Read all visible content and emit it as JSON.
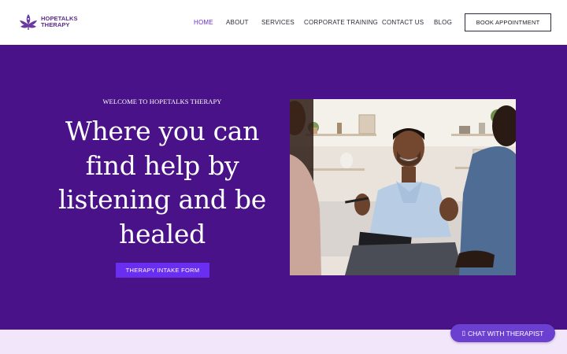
{
  "brand": {
    "name_line1": "HOPETALKS",
    "name_line2": "THERAPY",
    "logo_icon": "lotus-icon",
    "color": "#5a2a8c"
  },
  "nav": {
    "items": [
      {
        "label": "HOME",
        "active": true
      },
      {
        "label": "ABOUT",
        "active": false
      },
      {
        "label": "SERVICES",
        "active": false
      },
      {
        "label": "CORPORATE TRAINING",
        "active": false
      },
      {
        "label": "CONTACT US",
        "active": false
      },
      {
        "label": "BLOG",
        "active": false
      }
    ],
    "cta_label": "BOOK APPOINTMENT",
    "active_color": "#6b2bd9"
  },
  "hero": {
    "eyebrow": "WELCOME TO HOPETALKS THERAPY",
    "headline": "Where you can find help by listening and be healed",
    "button_label": "THERAPY INTAKE FORM",
    "background": "#4a1289",
    "button_color": "#6a2ef0",
    "photo_description_icon": "therapy-session-photo"
  },
  "chat": {
    "label": "CHAT WITH THERAPIST",
    "icon": "chat-icon",
    "color": "#6b3fd0"
  },
  "footer_band": {
    "background": "#f2e6fb"
  }
}
